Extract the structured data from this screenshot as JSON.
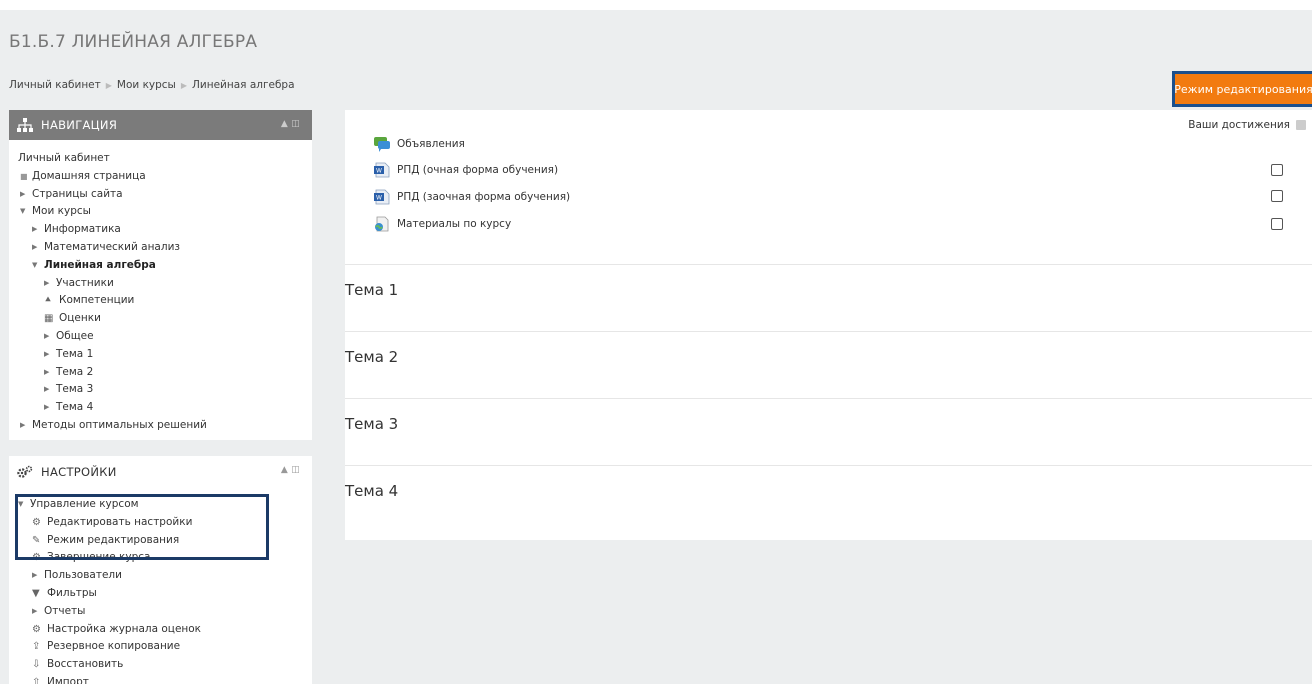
{
  "page": {
    "title": "Б1.Б.7 ЛИНЕЙНАЯ АЛГЕБРА",
    "breadcrumb": [
      "Личный кабинет",
      "Мои курсы",
      "Линейная алгебра"
    ],
    "edit_button": "Режим редактирования"
  },
  "navigation": {
    "title": "НАВИГАЦИЯ",
    "items": [
      {
        "label": "Личный кабинет"
      },
      {
        "label": "Домашняя страница"
      },
      {
        "label": "Страницы сайта"
      },
      {
        "label": "Мои курсы"
      },
      {
        "label": "Информатика"
      },
      {
        "label": "Математический анализ"
      },
      {
        "label": "Линейная алгебра"
      },
      {
        "label": "Участники"
      },
      {
        "label": "Компетенции"
      },
      {
        "label": "Оценки"
      },
      {
        "label": "Общее"
      },
      {
        "label": "Тема 1"
      },
      {
        "label": "Тема 2"
      },
      {
        "label": "Тема 3"
      },
      {
        "label": "Тема 4"
      },
      {
        "label": "Методы оптимальных решений"
      }
    ]
  },
  "settings": {
    "title": "НАСТРОЙКИ",
    "items": [
      {
        "label": "Управление курсом"
      },
      {
        "label": "Редактировать настройки"
      },
      {
        "label": "Режим редактирования"
      },
      {
        "label": "Завершение курса"
      },
      {
        "label": "Пользователи"
      },
      {
        "label": "Фильтры"
      },
      {
        "label": "Отчеты"
      },
      {
        "label": "Настройка журнала оценок"
      },
      {
        "label": "Резервное копирование"
      },
      {
        "label": "Восстановить"
      },
      {
        "label": "Импорт"
      }
    ]
  },
  "main": {
    "achievements": "Ваши достижения",
    "activities": [
      {
        "label": "Объявления",
        "icon": "forum-icon"
      },
      {
        "label": "РПД (очная форма обучения)",
        "icon": "word-document-icon"
      },
      {
        "label": "РПД (заочная форма обучения)",
        "icon": "word-document-icon"
      },
      {
        "label": "Материалы по курсу",
        "icon": "folder-icon"
      }
    ],
    "sections": [
      {
        "title": "Тема 1"
      },
      {
        "title": "Тема 2"
      },
      {
        "title": "Тема 3"
      },
      {
        "title": "Тема 4"
      }
    ]
  },
  "colors": {
    "accent": "#f27b10",
    "highlight": "#1b3a66",
    "background": "#eceeef"
  }
}
